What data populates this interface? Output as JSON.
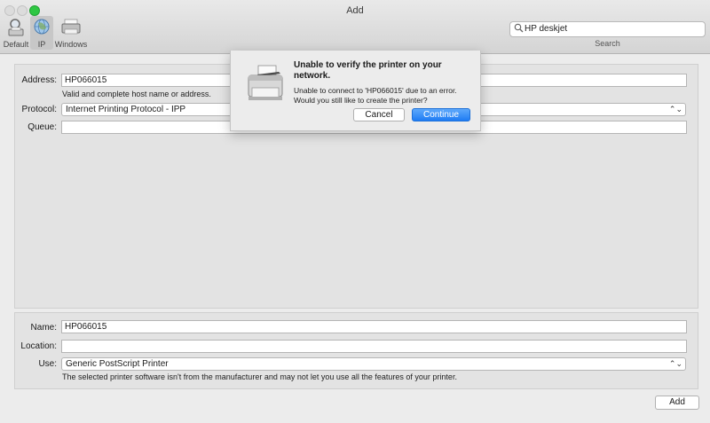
{
  "window": {
    "title": "Add"
  },
  "toolbar": {
    "default_label": "Default",
    "ip_label": "IP",
    "windows_label": "Windows"
  },
  "search": {
    "value": "HP deskjet",
    "label": "Search"
  },
  "form": {
    "address_label": "Address:",
    "address_value": "HP066015",
    "address_hint": "Valid and complete host name or address.",
    "protocol_label": "Protocol:",
    "protocol_value": "Internet Printing Protocol - IPP",
    "queue_label": "Queue:",
    "queue_value": "",
    "name_label": "Name:",
    "name_value": "HP066015",
    "location_label": "Location:",
    "location_value": "",
    "use_label": "Use:",
    "use_value": "Generic PostScript Printer",
    "use_hint": "The selected printer software isn't from the manufacturer and may not let you use all the features of your printer."
  },
  "add_button_label": "Add",
  "alert": {
    "title": "Unable to verify the printer on your network.",
    "message": "Unable to connect to 'HP066015' due to an error. Would you still like to create the printer?",
    "cancel_label": "Cancel",
    "continue_label": "Continue"
  },
  "colors": {
    "accent": "#1f7cf4",
    "close": "#dcdcdc",
    "zoom": "#2ec742"
  }
}
